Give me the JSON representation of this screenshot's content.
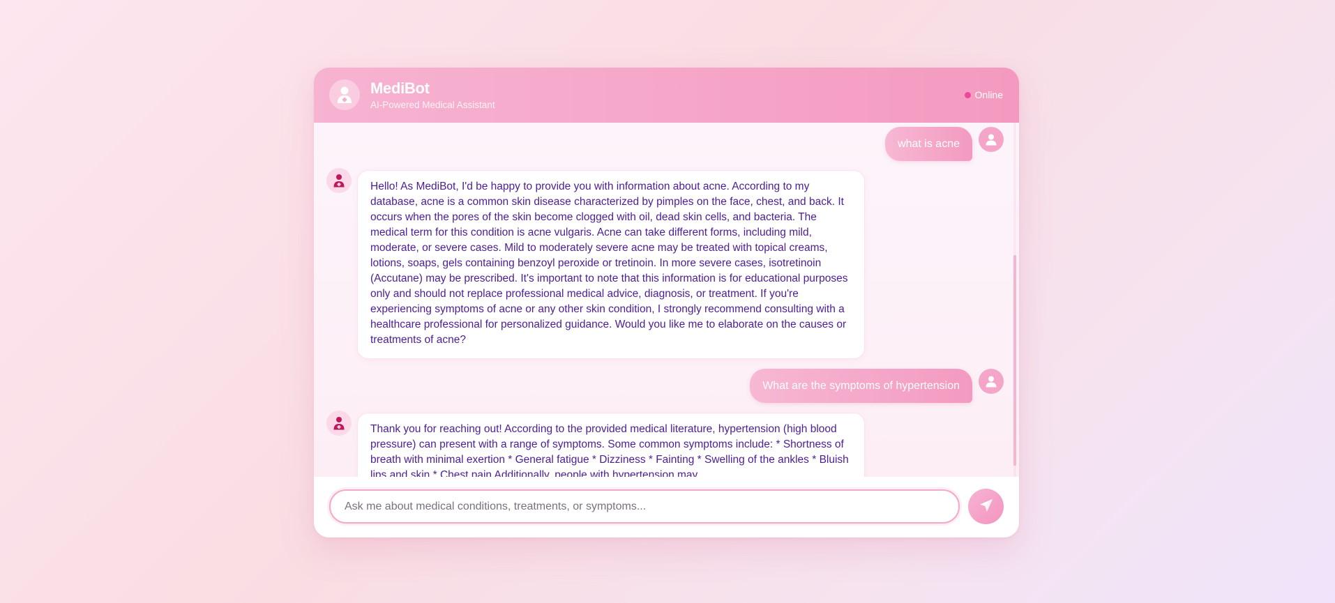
{
  "header": {
    "title": "MediBot",
    "subtitle": "AI-Powered Medical Assistant",
    "status": "Online"
  },
  "messages": [
    {
      "role": "user",
      "text": "what is acne"
    },
    {
      "role": "bot",
      "text": "Hello! As MediBot, I'd be happy to provide you with information about acne. According to my database, acne is a common skin disease characterized by pimples on the face, chest, and back. It occurs when the pores of the skin become clogged with oil, dead skin cells, and bacteria. The medical term for this condition is acne vulgaris. Acne can take different forms, including mild, moderate, or severe cases. Mild to moderately severe acne may be treated with topical creams, lotions, soaps, gels containing benzoyl peroxide or tretinoin. In more severe cases, isotretinoin (Accutane) may be prescribed. It's important to note that this information is for educational purposes only and should not replace professional medical advice, diagnosis, or treatment. If you're experiencing symptoms of acne or any other skin condition, I strongly recommend consulting with a healthcare professional for personalized guidance. Would you like me to elaborate on the causes or treatments of acne?"
    },
    {
      "role": "user",
      "text": "What are the symptoms of hypertension"
    },
    {
      "role": "bot",
      "text": "Thank you for reaching out! According to the provided medical literature, hypertension (high blood pressure) can present with a range of symptoms. Some common symptoms include: * Shortness of breath with minimal exertion * General fatigue * Dizziness * Fainting * Swelling of the ankles * Bluish lips and skin * Chest pain Additionally, people with hypertension may"
    }
  ],
  "composer": {
    "placeholder": "Ask me about medical conditions, treatments, or symptoms..."
  },
  "icons": {
    "header_avatar": "doctor-icon",
    "user_avatar": "user-icon",
    "bot_avatar": "doctor-icon",
    "send": "paper-plane-icon"
  },
  "colors": {
    "accent": "#f49ac0",
    "status_dot": "#ec4899",
    "bot_text": "#4c1d95"
  }
}
